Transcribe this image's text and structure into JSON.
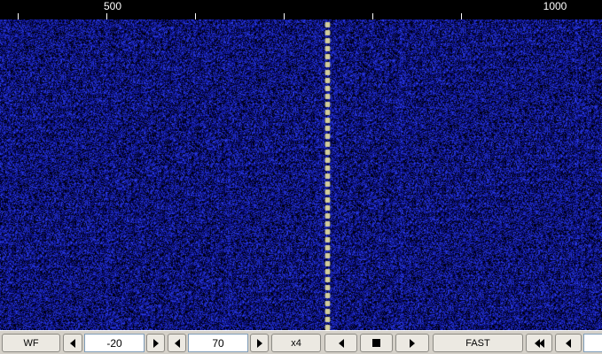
{
  "scale": {
    "labels": [
      "500",
      "1000"
    ]
  },
  "toolbar": {
    "wf_label": "WF",
    "reference_value": "-20",
    "range_value": "70",
    "zoom_label": "x4",
    "speed_label": "FAST"
  },
  "colors": {
    "waterfall_base": "#00008c",
    "waterfall_peak": "#3c50ff",
    "signal_trace": "#d2cc9c",
    "toolbar_bg": "#d4d0c8"
  },
  "icons": {
    "ref_decrease": "triangle-left-icon",
    "ref_increase": "triangle-right-icon",
    "range_decrease": "triangle-left-icon",
    "range_increase": "triangle-right-icon",
    "play_back": "triangle-left-icon",
    "stop": "square-stop-icon",
    "play_forward": "triangle-right-icon",
    "fast_rewind": "double-triangle-left-icon",
    "step_back": "triangle-left-icon"
  }
}
